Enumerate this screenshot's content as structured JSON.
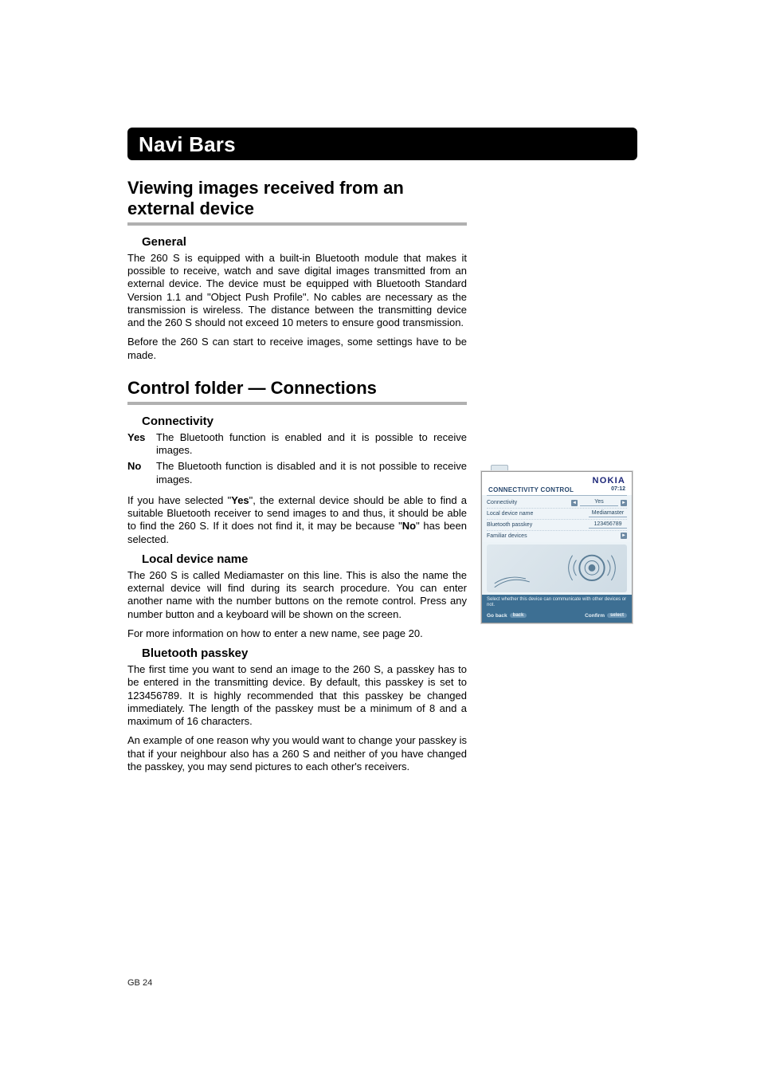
{
  "header": {
    "navi_bar": "Navi Bars"
  },
  "sections": {
    "viewing": {
      "title": "Viewing images received from an external device",
      "general_h": "General",
      "general_p1": "The 260 S is equipped with a built-in Bluetooth module that makes it possible to receive, watch and save digital images transmitted from an external device. The device must be equipped with Bluetooth Standard Version 1.1 and \"Object Push Profile\". No cables are necessary as the transmission is wireless. The distance between the transmitting device and the 260 S should not exceed 10 meters to ensure good transmission.",
      "general_p2": "Before the 260 S can start to receive images, some settings have to be made."
    },
    "control": {
      "title": "Control folder — Connections",
      "connectivity_h": "Connectivity",
      "def_yes_term": "Yes",
      "def_yes_desc": "The Bluetooth function is enabled and it is possible to receive images.",
      "def_no_term": "No",
      "def_no_desc": "The Bluetooth function is disabled and it is not possible to receive images.",
      "connectivity_p_pre": "If you have selected \"",
      "connectivity_p_b1": "Yes",
      "connectivity_p_mid": "\", the external device should be able to find a suitable Bluetooth receiver to send images to and thus, it should be able to find the 260 S. If it does not find it, it may be because \"",
      "connectivity_p_b2": "No",
      "connectivity_p_post": "\" has been selected.",
      "local_h": "Local device name",
      "local_p1": "The 260 S is called Mediamaster on this line. This is also the name the external device will find during its search procedure. You can enter another name with the number buttons on the remote control. Press any number button and a keyboard will be shown on the screen.",
      "local_p2": "For more information on how to enter a new name, see page 20.",
      "passkey_h": "Bluetooth passkey",
      "passkey_p1": "The first time you want to send an image to the 260 S, a passkey has to be entered in the transmitting device. By default, this passkey is set to 123456789. It is highly recommended that this passkey be changed immediately. The length of the passkey must be a minimum of 8 and a maximum of 16 characters.",
      "passkey_p2": "An example of one reason why you would want to change your passkey is that if your neighbour also has a 260 S and neither of you have changed the passkey, you may send pictures to each other's receivers."
    }
  },
  "figure": {
    "brand": "NOKIA",
    "title": "CONNECTIVITY CONTROL",
    "time": "07:12",
    "rows": {
      "r1_label": "Connectivity",
      "r1_value": "Yes",
      "r2_label": "Local device name",
      "r2_value": "Mediamaster",
      "r3_label": "Bluetooth passkey",
      "r3_value": "123456789",
      "r4_label": "Familiar devices",
      "r4_value": ""
    },
    "hint": "Select whether this device can communicate with other devices or not.",
    "btn_left_label": "Go back",
    "btn_left_key": "back",
    "btn_right_label": "Confirm",
    "btn_right_key": "select"
  },
  "footer": {
    "page": "GB 24"
  }
}
